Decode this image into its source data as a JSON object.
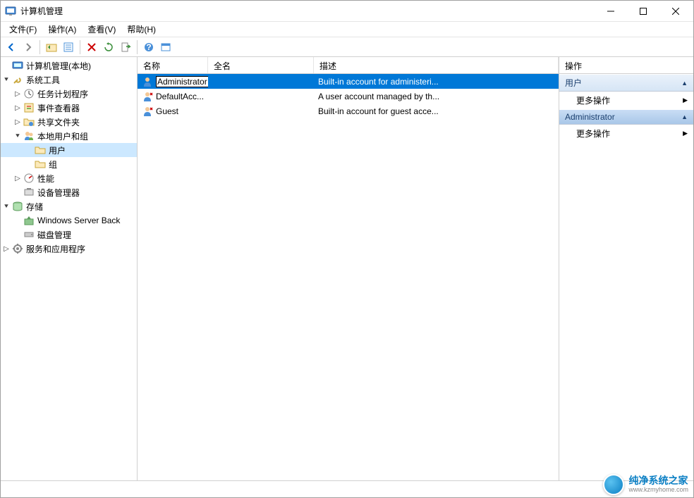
{
  "window": {
    "title": "计算机管理"
  },
  "menu": {
    "file": "文件(F)",
    "action": "操作(A)",
    "view": "查看(V)",
    "help": "帮助(H)"
  },
  "tree": {
    "root": "计算机管理(本地)",
    "system_tools": "系统工具",
    "task_scheduler": "任务计划程序",
    "event_viewer": "事件查看器",
    "shared_folders": "共享文件夹",
    "local_users_groups": "本地用户和组",
    "users": "用户",
    "groups": "组",
    "performance": "性能",
    "device_manager": "设备管理器",
    "storage": "存储",
    "windows_server_backup": "Windows Server Back",
    "disk_management": "磁盘管理",
    "services_apps": "服务和应用程序"
  },
  "columns": {
    "name": "名称",
    "fullname": "全名",
    "description": "描述"
  },
  "users_list": [
    {
      "name": "Administrator",
      "fullname": "",
      "description": "Built-in account for administeri...",
      "selected": true
    },
    {
      "name": "DefaultAcc...",
      "fullname": "",
      "description": "A user account managed by th...",
      "selected": false
    },
    {
      "name": "Guest",
      "fullname": "",
      "description": "Built-in account for guest acce...",
      "selected": false
    }
  ],
  "actions": {
    "header": "操作",
    "group1": "用户",
    "more_actions": "更多操作",
    "group2": "Administrator"
  },
  "watermark": {
    "zh": "纯净系统之家",
    "en": "www.kzmyhome.com"
  }
}
